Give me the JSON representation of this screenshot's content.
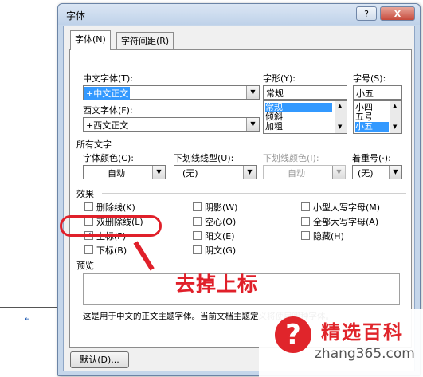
{
  "dialog": {
    "title": "字体",
    "help_label": "?",
    "close_label": "X"
  },
  "tabs": [
    {
      "label": "字体(N)"
    },
    {
      "label": "字符间距(R)"
    }
  ],
  "font": {
    "cn_label": "中文字体(T):",
    "cn_value": "+中文正文",
    "west_label": "西文字体(F):",
    "west_value": "+西文正文",
    "style_label": "字形(Y):",
    "style_value": "常规",
    "style_options": [
      "常规",
      "倾斜",
      "加粗"
    ],
    "size_label": "字号(S):",
    "size_value": "小五",
    "size_options": [
      "小四",
      "五号",
      "小五"
    ]
  },
  "all_text": {
    "group_label": "所有文字",
    "color_label": "字体颜色(C):",
    "color_value": "自动",
    "underline_label": "下划线线型(U):",
    "underline_value": "(无)",
    "underline_color_label": "下划线颜色(I):",
    "underline_color_value": "自动",
    "emphasis_label": "着重号(·):",
    "emphasis_value": "(无)"
  },
  "effects": {
    "group_label": "效果",
    "items": [
      {
        "label": "删除线(K)",
        "checked": false
      },
      {
        "label": "双删除线(L)",
        "checked": false
      },
      {
        "label": "上标(P)",
        "checked": true
      },
      {
        "label": "下标(B)",
        "checked": false
      },
      {
        "label": "阴影(W)",
        "checked": false
      },
      {
        "label": "空心(O)",
        "checked": false
      },
      {
        "label": "阳文(E)",
        "checked": false
      },
      {
        "label": "阴文(G)",
        "checked": false
      },
      {
        "label": "小型大写字母(M)",
        "checked": false
      },
      {
        "label": "全部大写字母(A)",
        "checked": false
      },
      {
        "label": "隐藏(H)",
        "checked": false
      }
    ]
  },
  "preview": {
    "group_label": "预览",
    "note": "这是用于中文的正文主题字体。当前文档主题定义将使用哪种字体。"
  },
  "buttons": {
    "default_label": "默认(D)..."
  },
  "annotation": {
    "text": "去掉上标"
  },
  "watermark": {
    "icon": "?",
    "brand": "精选百科",
    "url": "zhang365.com"
  },
  "colors": {
    "accent": "#e0202a",
    "selection": "#3399ff",
    "window": "#c5d6ea"
  }
}
